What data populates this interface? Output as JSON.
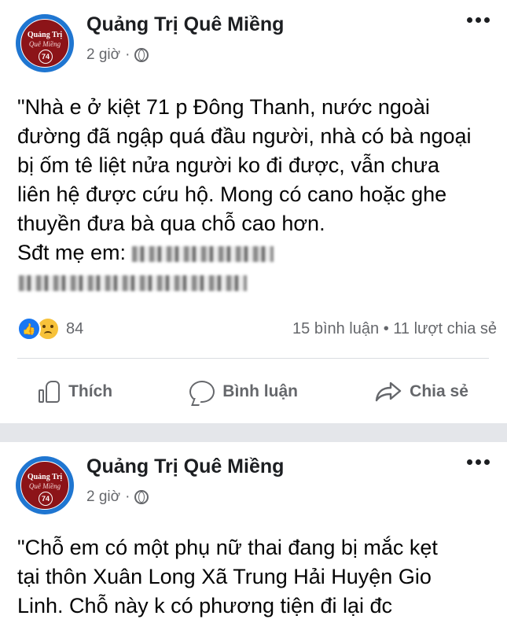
{
  "posts": [
    {
      "page_name": "Quảng Trị Quê Miềng",
      "time": "2 giờ",
      "visibility_icon": "globe-icon",
      "logo": {
        "title": "Quảng Trị",
        "script": "Quê Miềng",
        "number": "74"
      },
      "text_lines": [
        "\"Nhà e ở kiệt 71 p Đông Thanh, nước ngoài",
        "đường đã ngập quá đầu người, nhà có bà ngoại",
        "bị ốm tê liệt nửa người ko đi được, vẫn chưa",
        "liên hệ được cứu hộ. Mong có cano hoặc ghe",
        "thuyền đưa bà qua chỗ cao hơn."
      ],
      "phone_label": "Sđt mẹ em:",
      "reaction_count": "84",
      "comments": "15 bình luận",
      "shares": "11 lượt chia sẻ"
    },
    {
      "page_name": "Quảng Trị Quê Miềng",
      "time": "2 giờ",
      "visibility_icon": "globe-icon",
      "logo": {
        "title": "Quảng Trị",
        "script": "Quê Miềng",
        "number": "74"
      },
      "text_lines": [
        "\"Chỗ em có một phụ nữ thai đang bị mắc kẹt",
        "tại thôn Xuân Long Xã Trung Hải Huyện Gio",
        "Linh. Chỗ này k có phương tiện đi lại đc"
      ]
    }
  ],
  "actions": {
    "like": "Thích",
    "comment": "Bình luận",
    "share": "Chia sẻ"
  },
  "colors": {
    "accent": "#1877f2",
    "secondary_text": "#65676b",
    "separator": "#e4e6ea",
    "logo_bg": "#8c1418",
    "logo_ring": "#1f76d1"
  }
}
